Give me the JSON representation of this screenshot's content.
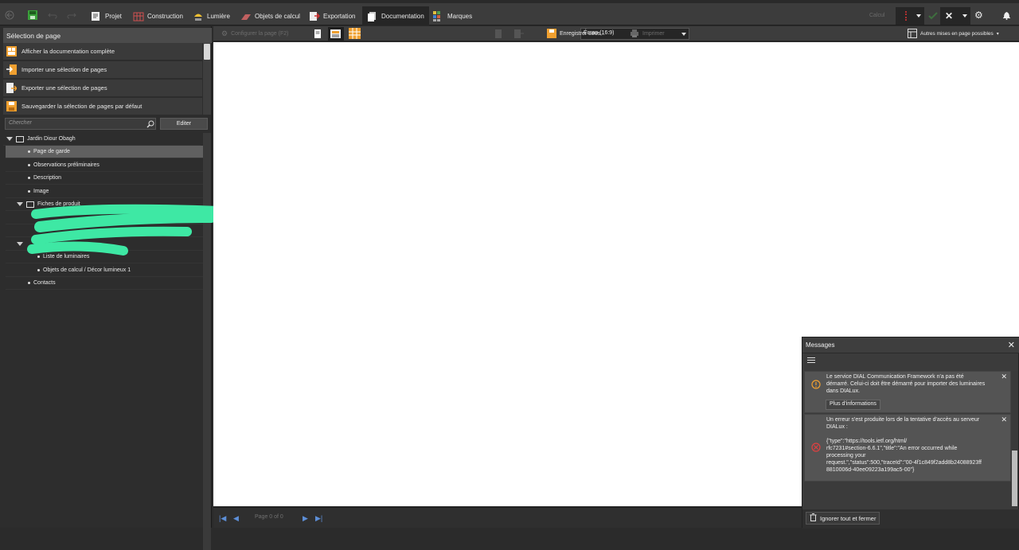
{
  "topbar": {
    "menu": [
      {
        "label": "Projet"
      },
      {
        "label": "Construction"
      },
      {
        "label": "Lumière"
      },
      {
        "label": "Objets de calcul"
      },
      {
        "label": "Exportation"
      },
      {
        "label": "Documentation"
      },
      {
        "label": "Marques"
      }
    ],
    "calcul_label": "Calcul"
  },
  "left_panel": {
    "title": "Sélection de page",
    "actions": [
      {
        "label": "Afficher la documentation complète"
      },
      {
        "label": "Importer une sélection de pages"
      },
      {
        "label": "Exporter une sélection de pages"
      },
      {
        "label": "Sauvegarder la sélection de pages par défaut"
      }
    ],
    "search_placeholder": "Chercher",
    "edit_label": "Editer",
    "tree": [
      {
        "label": "Jardin Diour Obagh"
      },
      {
        "label": "Page de garde"
      },
      {
        "label": "Observations préliminaires"
      },
      {
        "label": "Description"
      },
      {
        "label": "Image"
      },
      {
        "label": "Fiches de produit"
      },
      {
        "label": "Liste de luminaires"
      },
      {
        "label": "Objets de calcul / Décor lumineux 1"
      },
      {
        "label": "Contacts"
      }
    ]
  },
  "doc_toolbar": {
    "configure_label": "Configurer la page (F2)",
    "screen_value": "Écran (16:9)",
    "save_as_label": "Enregistrer sous...",
    "print_label": "Imprimer",
    "layouts_label": "Autres mises en page possibles"
  },
  "pager": {
    "page_label": "Page 0 of 0"
  },
  "messages": {
    "title": "Messages",
    "items": [
      {
        "text": "Le service DIAL Communication Framework n'a pas été\ndémarré. Celui-ci doit être démarré pour importer des luminaires\ndans DIALux.",
        "button": "Plus d'informations"
      },
      {
        "text": "Un erreur s'est produite lors de la tentative d'accès au serveur\nDIALux :\n\n{\"type\":\"https://tools.ietf.org/html/\nrfc7231#section-6.6.1\",\"title\":\"An error occurred while\nprocessing your\nrequest.\",\"status\":500,\"traceId\":\"00-4f1c849f2add8b24088923ff\n8810006d-40ee09223a199ac5-00\"}"
      }
    ],
    "ignore_label": "Ignorer tout et fermer"
  },
  "colors": {
    "accent_orange": "#f0a030",
    "error_red": "#e04040",
    "nav_blue": "#5d8fd8"
  }
}
